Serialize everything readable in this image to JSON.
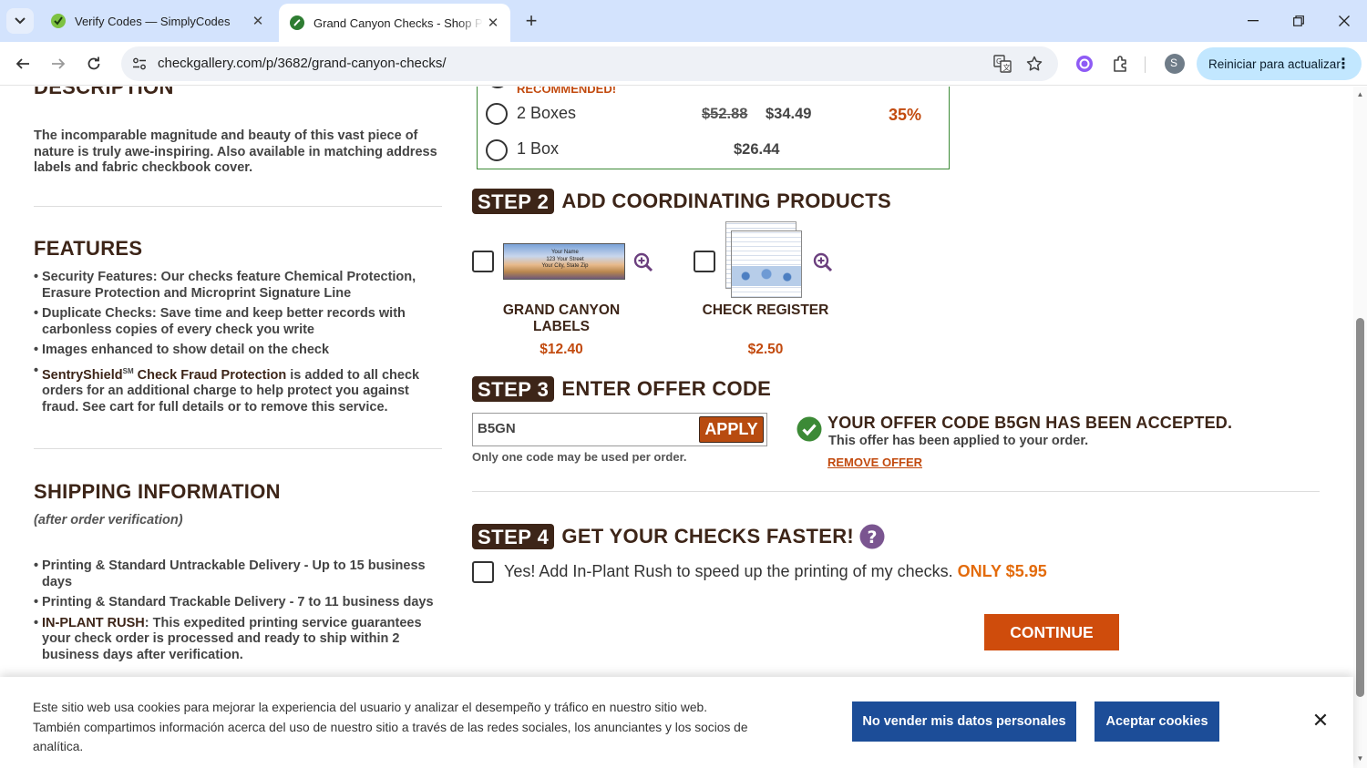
{
  "browser": {
    "tabs": [
      {
        "title": "Verify Codes — SimplyCodes",
        "icon": "simplycodes-favicon"
      },
      {
        "title": "Grand Canyon Checks - Shop P",
        "icon": "checkgallery-favicon"
      }
    ],
    "url": "checkgallery.com/p/3682/grand-canyon-checks/",
    "update_label": "Reiniciar para actualizar",
    "profile_initial": "S"
  },
  "left": {
    "description_heading": "DESCRIPTION",
    "description": "The incomparable magnitude and beauty of this vast piece of nature is truly awe-inspiring. Also available in matching address labels and fabric checkbook cover.",
    "features_heading": "FEATURES",
    "features": [
      "Security Features: Our checks feature Chemical Protection, Erasure Protection and Microprint Signature Line",
      "Duplicate Checks: Save time and keep better records with carbonless copies of every check you write",
      "Images enhanced to show detail on the check"
    ],
    "sentry": {
      "brand": "SentryShield",
      "sup": "SM",
      "bold": " Check Fraud Protection",
      "rest": " is added to all check orders for an additional charge to help protect you against fraud. See cart for full details or to remove this service."
    },
    "shipping_heading": "SHIPPING INFORMATION",
    "shipping_note": "(after order verification)",
    "shipping": [
      "Printing & Standard Untrackable Delivery - Up to 15 business days",
      "Printing & Standard Trackable Delivery - 7 to 11 business days"
    ],
    "rush": {
      "bold": "IN-PLANT RUSH",
      "rest": ": This expedited printing service guarantees your check order is processed and ready to ship within 2 business days after verification."
    }
  },
  "quantity": {
    "recommended_label": "RECOMMENDED!",
    "options": [
      {
        "label": "2 Boxes",
        "old_price": "$52.88",
        "price": "$34.49",
        "savings": "35%"
      },
      {
        "label": "1 Box",
        "price": "$26.44"
      }
    ]
  },
  "step2": {
    "badge": "STEP 2",
    "title": "ADD COORDINATING PRODUCTS",
    "products": [
      {
        "name": "GRAND CANYON LABELS",
        "price": "$12.40",
        "label_lines": [
          "Your Name",
          "123 Your Street",
          "Your City, State Zip"
        ]
      },
      {
        "name": "CHECK REGISTER",
        "price": "$2.50"
      }
    ]
  },
  "step3": {
    "badge": "STEP 3",
    "title": "ENTER OFFER CODE",
    "code_value": "B5GN",
    "apply_label": "APPLY",
    "note": "Only one code may be used per order.",
    "accepted_title": "YOUR OFFER CODE B5GN HAS BEEN ACCEPTED.",
    "accepted_sub": "This offer has been applied to your order.",
    "remove_label": "REMOVE OFFER"
  },
  "step4": {
    "badge": "STEP 4",
    "title": "GET YOUR CHECKS FASTER!",
    "rush_label": "Yes! Add In-Plant Rush to speed up the printing of my checks.",
    "rush_price": "ONLY $5.95",
    "continue_label": "CONTINUE"
  },
  "cookie": {
    "text": "Este sitio web usa cookies para mejorar la experiencia del usuario y analizar el desempeño y tráfico en nuestro sitio web. También compartimos información acerca del uso de nuestro sitio a través de las redes sociales, los anunciantes y los socios de analítica.",
    "dont_sell_label": "No vender mis datos personales",
    "accept_label": "Aceptar cookies"
  },
  "colors": {
    "brand_brown": "#3d2518",
    "price_orange": "#c24a0e",
    "continue_orange": "#cf4c0c",
    "success_green": "#3c8a36",
    "cookie_blue": "#1c4d98",
    "chrome_tab_bg": "#d3e3fd"
  }
}
